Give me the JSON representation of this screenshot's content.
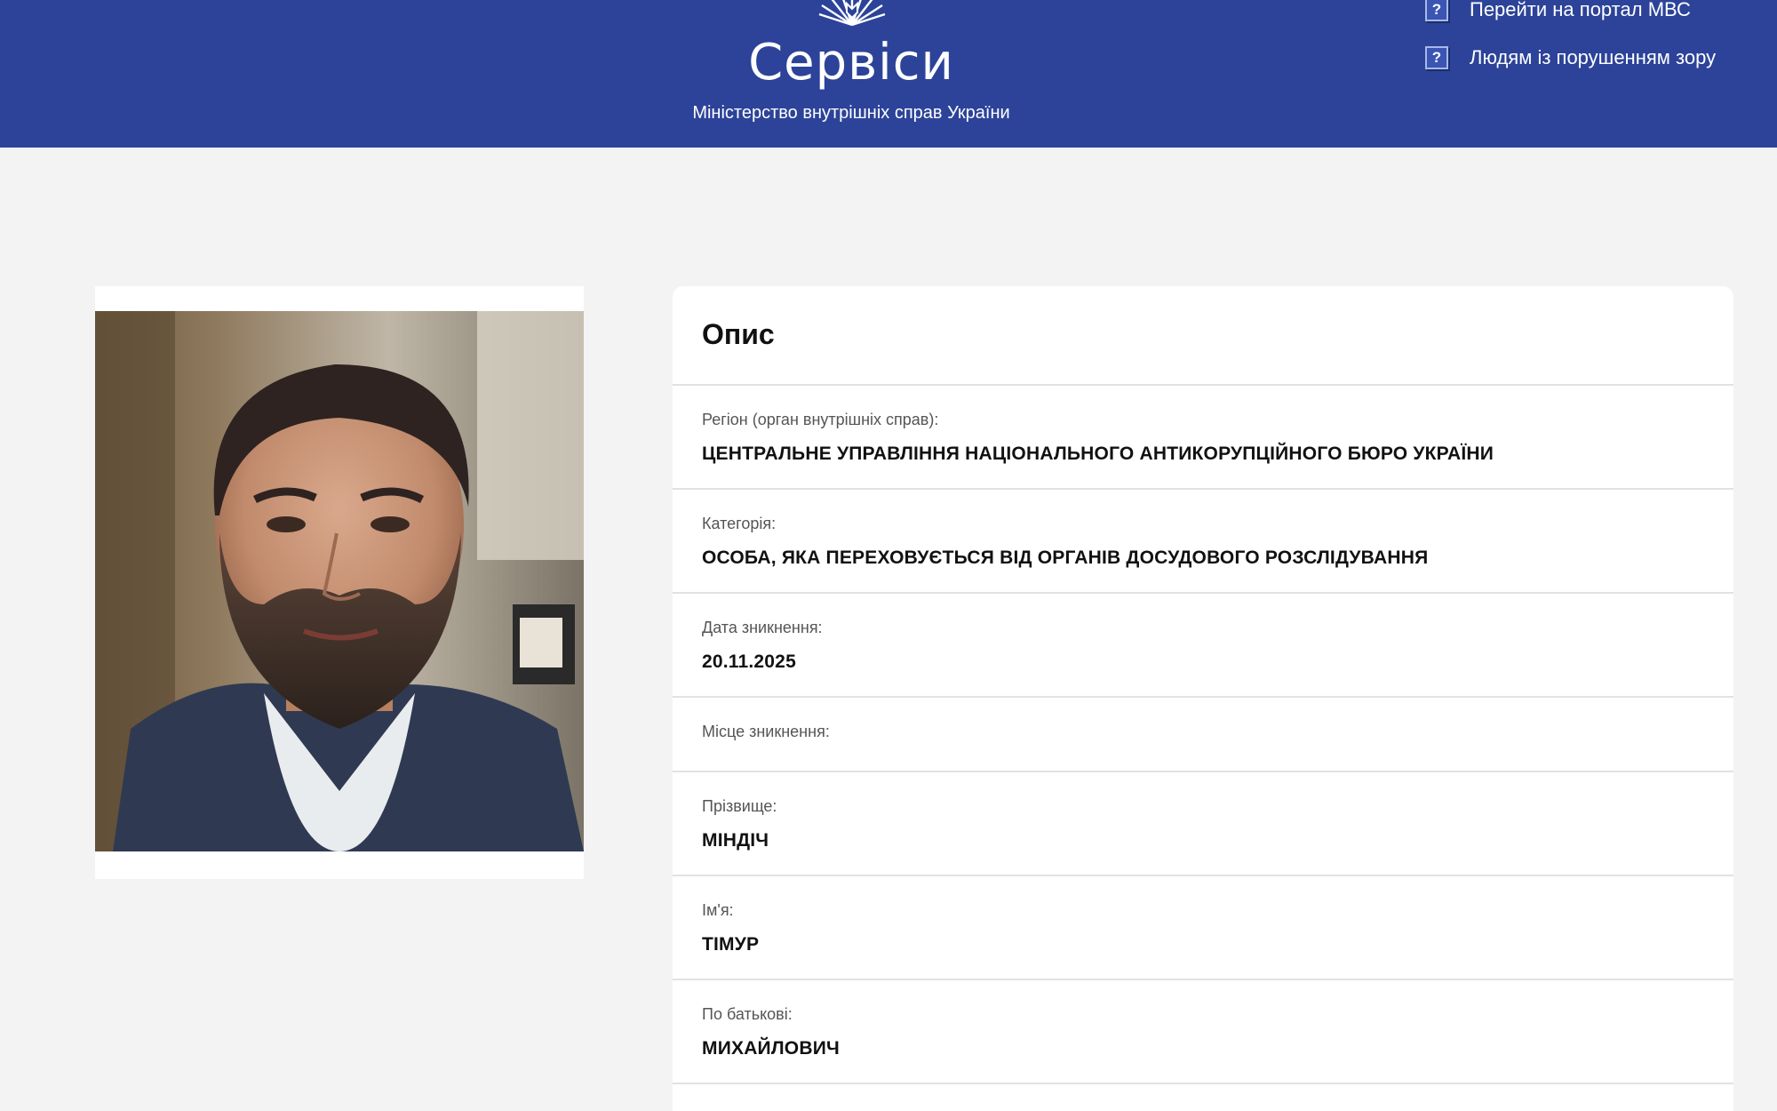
{
  "header": {
    "brand_title": "Сервіси",
    "brand_subtitle": "Міністерство внутрішніх справ України",
    "links": [
      {
        "label": "Перейти на портал МВС",
        "icon": "help-icon"
      },
      {
        "label": "Людям із порушенням зору",
        "icon": "help-icon"
      }
    ],
    "colors": {
      "header_bg": "#2c4399",
      "page_bg": "#f3f3f3"
    }
  },
  "photo": {
    "alt": "person-photo"
  },
  "description": {
    "title": "Опис",
    "fields": [
      {
        "label": "Регіон (орган внутрішніх справ):",
        "value": "ЦЕНТРАЛЬНЕ УПРАВЛІННЯ НАЦІОНАЛЬНОГО АНТИКОРУПЦІЙНОГО БЮРО УКРАЇНИ"
      },
      {
        "label": "Категорія:",
        "value": "ОСОБА, ЯКА ПЕРЕХОВУЄТЬСЯ ВІД ОРГАНІВ ДОСУДОВОГО РОЗСЛІДУВАННЯ"
      },
      {
        "label": "Дата зникнення:",
        "value": "20.11.2025"
      },
      {
        "label": "Місце зникнення:",
        "value": ""
      },
      {
        "label": "Прізвище:",
        "value": "МІНДІЧ"
      },
      {
        "label": "Ім'я:",
        "value": "ТІМУР"
      },
      {
        "label": "По батькові:",
        "value": "МИХАЙЛОВИЧ"
      }
    ]
  }
}
